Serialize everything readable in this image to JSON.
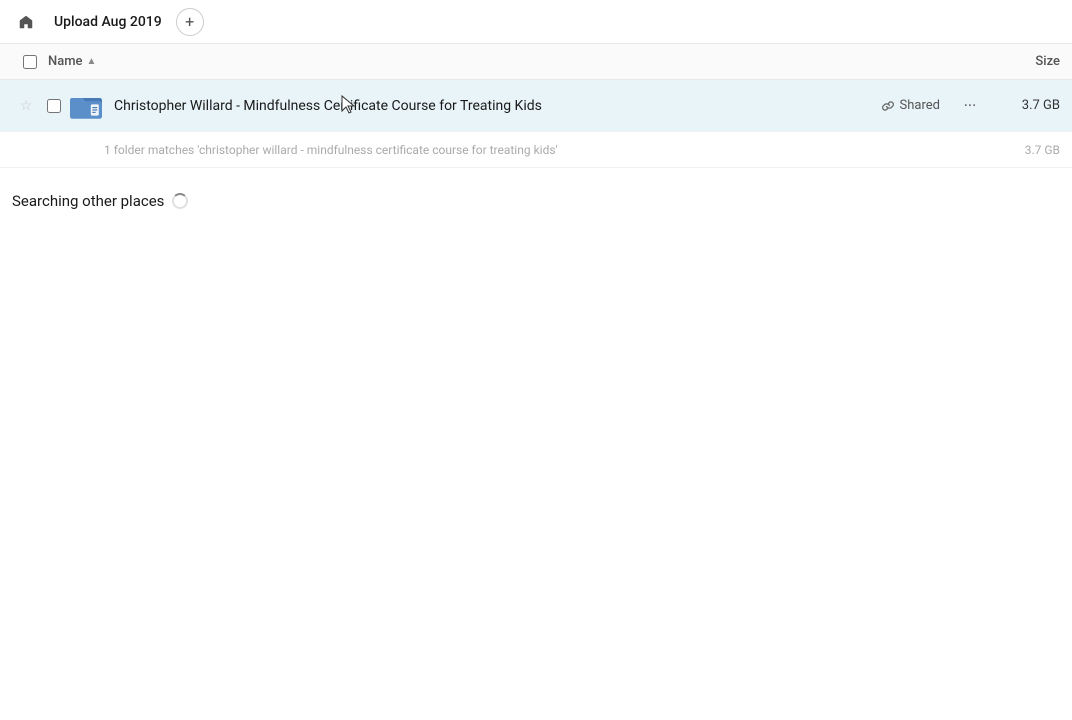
{
  "topbar": {
    "home_label": "Upload Aug 2019",
    "add_button_label": "+",
    "home_icon": "🏠"
  },
  "columns": {
    "name_label": "Name",
    "sort_indicator": "▲",
    "size_label": "Size"
  },
  "file_row": {
    "name": "Christopher Willard - Mindfulness Certificate Course for Treating Kids",
    "shared_label": "Shared",
    "size": "3.7 GB",
    "star_icon": "☆",
    "more_icon": "···"
  },
  "match_row": {
    "text": "1 folder matches 'christopher willard - mindfulness certificate course for treating kids'",
    "size": "3.7 GB"
  },
  "searching_section": {
    "label": "Searching other places"
  }
}
